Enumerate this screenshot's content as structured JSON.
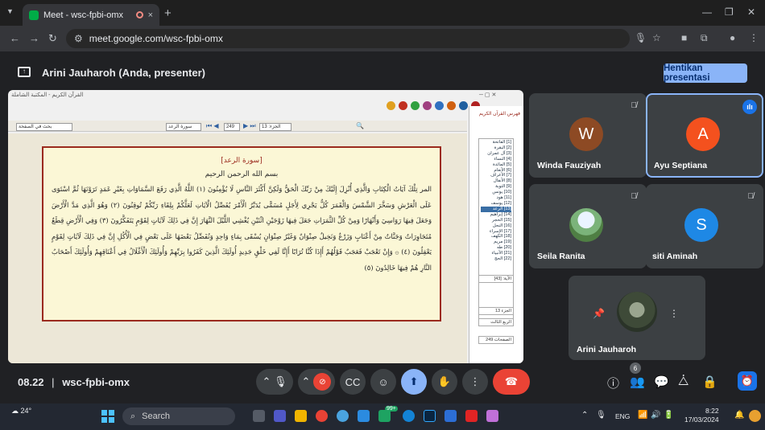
{
  "browser": {
    "tab_title": "Meet - wsc-fpbi-omx",
    "tab_close": "×",
    "new_tab": "+",
    "url": "meet.google.com/wsc-fpbi-omx"
  },
  "header": {
    "presenter_label": "Arini Jauharoh (Anda, presenter)",
    "stop_button": "Hentikan presentasi"
  },
  "shared_screen": {
    "window_title": "القرآن الكريم - المكتبة الشاملة",
    "search_placeholder_left": "بحث في الصفحة",
    "surah_select": "سورة الرعد",
    "page_number": "249",
    "juz_select": "الجزء: 13",
    "surah_heading": "[سورة الرعد]",
    "basmala": "بسم الله الرحمن الرحيم",
    "verses_text": "المر تِلْكَ آيَاتُ الْكِتَابِ وَالَّذِي أُنْزِلَ إِلَيْكَ مِنْ رَبِّكَ الْحَقُّ وَلَكِنَّ أَكْثَرَ النَّاسِ لَا يُؤْمِنُونَ (١) اللَّهُ الَّذِي رَفَعَ السَّمَاوَاتِ بِغَيْرِ عَمَدٍ تَرَوْنَهَا ثُمَّ اسْتَوَى عَلَى الْعَرْشِ وَسَخَّرَ الشَّمْسَ وَالْقَمَرَ كُلٌّ يَجْرِي لِأَجَلٍ مُسَمًّى يُدَبِّرُ الْأَمْرَ يُفَصِّلُ الْآيَاتِ لَعَلَّكُمْ بِلِقَاءِ رَبِّكُمْ تُوقِنُونَ (٢) وَهُوَ الَّذِي مَدَّ الْأَرْضَ وَجَعَلَ فِيهَا رَوَاسِيَ وَأَنْهَارًا وَمِنْ كُلِّ الثَّمَرَاتِ جَعَلَ فِيهَا زَوْجَيْنِ اثْنَيْنِ يُغْشِي اللَّيْلَ النَّهَارَ إِنَّ فِي ذَلِكَ لَآيَاتٍ لِقَوْمٍ يَتَفَكَّرُونَ (٣) وَفِي الْأَرْضِ قِطَعٌ مُتَجَاوِرَاتٌ وَجَنَّاتٌ مِنْ أَعْنَابٍ وَزَرْعٌ وَنَخِيلٌ صِنْوَانٌ وَغَيْرُ صِنْوَانٍ يُسْقَى بِمَاءٍ وَاحِدٍ وَنُفَضِّلُ بَعْضَهَا عَلَى بَعْضٍ فِي الْأُكُلِ إِنَّ فِي ذَلِكَ لَآيَاتٍ لِقَوْمٍ يَعْقِلُونَ (٤) ۞ وَإِنْ تَعْجَبْ فَعَجَبٌ قَوْلُهُمْ أَإِذَا كُنَّا تُرَابًا أَإِنَّا لَفِي خَلْقٍ جَدِيدٍ أُولَئِكَ الَّذِينَ كَفَرُوا بِرَبِّهِمْ وَأُولَئِكَ الْأَغْلَالُ فِي أَعْنَاقِهِمْ وَأُولَئِكَ أَصْحَابُ النَّارِ هُمْ فِيهَا خَالِدُونَ (٥)",
    "side_title": "فهرس القرآن الكريم",
    "surah_list": [
      "[1] الفاتحة",
      "[2] البقرة",
      "[3] آل عمران",
      "[4] النساء",
      "[5] المائدة",
      "[6] الأنعام",
      "[7] الأعراف",
      "[8] الأنفال",
      "[9] التوبة",
      "[10] يونس",
      "[11] هود",
      "[12] يوسف",
      "[13] الرعد",
      "[14] إبراهيم",
      "[15] الحجر",
      "[16] النحل",
      "[17] الإسراء",
      "[18] الكهف",
      "[19] مريم",
      "[20] طه",
      "[21] الأنبياء",
      "[22] الحج"
    ],
    "selected_surah_index": 12,
    "ayah_field": "الآية: [43]",
    "juz_field": "الجزء 13",
    "hizb_field": "الربع الثالث",
    "page_field": "الصفحات 249"
  },
  "participants": [
    {
      "name": "Winda Fauziyah",
      "initial": "W",
      "color": "#8d4a24",
      "muted": true,
      "active": false
    },
    {
      "name": "Ayu Septiana",
      "initial": "A",
      "color": "#f4511e",
      "muted": false,
      "active": true
    },
    {
      "name": "Seila Ranita",
      "initial": "",
      "color": "#6a9a5b",
      "muted": true,
      "active": false
    },
    {
      "name": "siti Aminah",
      "initial": "S",
      "color": "#1e88e5",
      "muted": true,
      "active": false
    },
    {
      "name": "Arini Jauharoh",
      "initial": "",
      "color": "#3b4a3a",
      "muted": false,
      "active": false
    }
  ],
  "bottom_bar": {
    "time": "08.22",
    "separator": "|",
    "meeting_code": "wsc-fpbi-omx",
    "people_count": "6"
  },
  "taskbar": {
    "weather": "24°",
    "search_placeholder": "Search",
    "language": "ENG",
    "time": "8:22",
    "date": "17/03/2024",
    "badge": "99+"
  },
  "colors": {
    "accent": "#8ab4f8",
    "end_call": "#ea4335",
    "quran_border": "#9b2a1e"
  }
}
